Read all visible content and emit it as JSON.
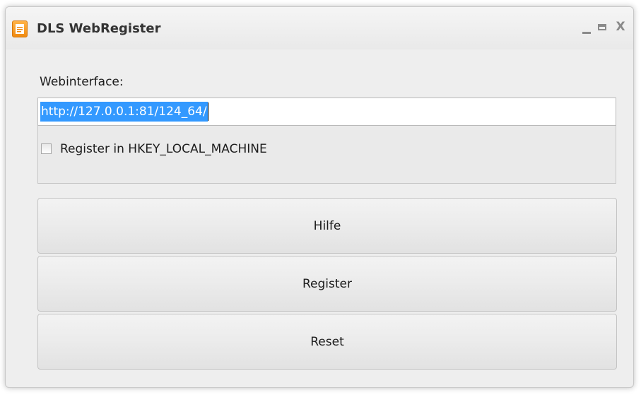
{
  "window": {
    "title": "DLS WebRegister",
    "controls": {
      "minimize_icon": "minimize-icon",
      "maximize_icon": "maximize-icon",
      "close_label": "X"
    }
  },
  "form": {
    "webinterface_label": "Webinterface:",
    "webinterface_value": "http://127.0.0.1:81/124_64/",
    "register_hklm_label": "Register in HKEY_LOCAL_MACHINE",
    "register_hklm_checked": false
  },
  "buttons": {
    "hilfe": "Hilfe",
    "register": "Register",
    "reset": "Reset"
  },
  "colors": {
    "accent_icon": "#f08a10",
    "selection": "#3399ff"
  }
}
